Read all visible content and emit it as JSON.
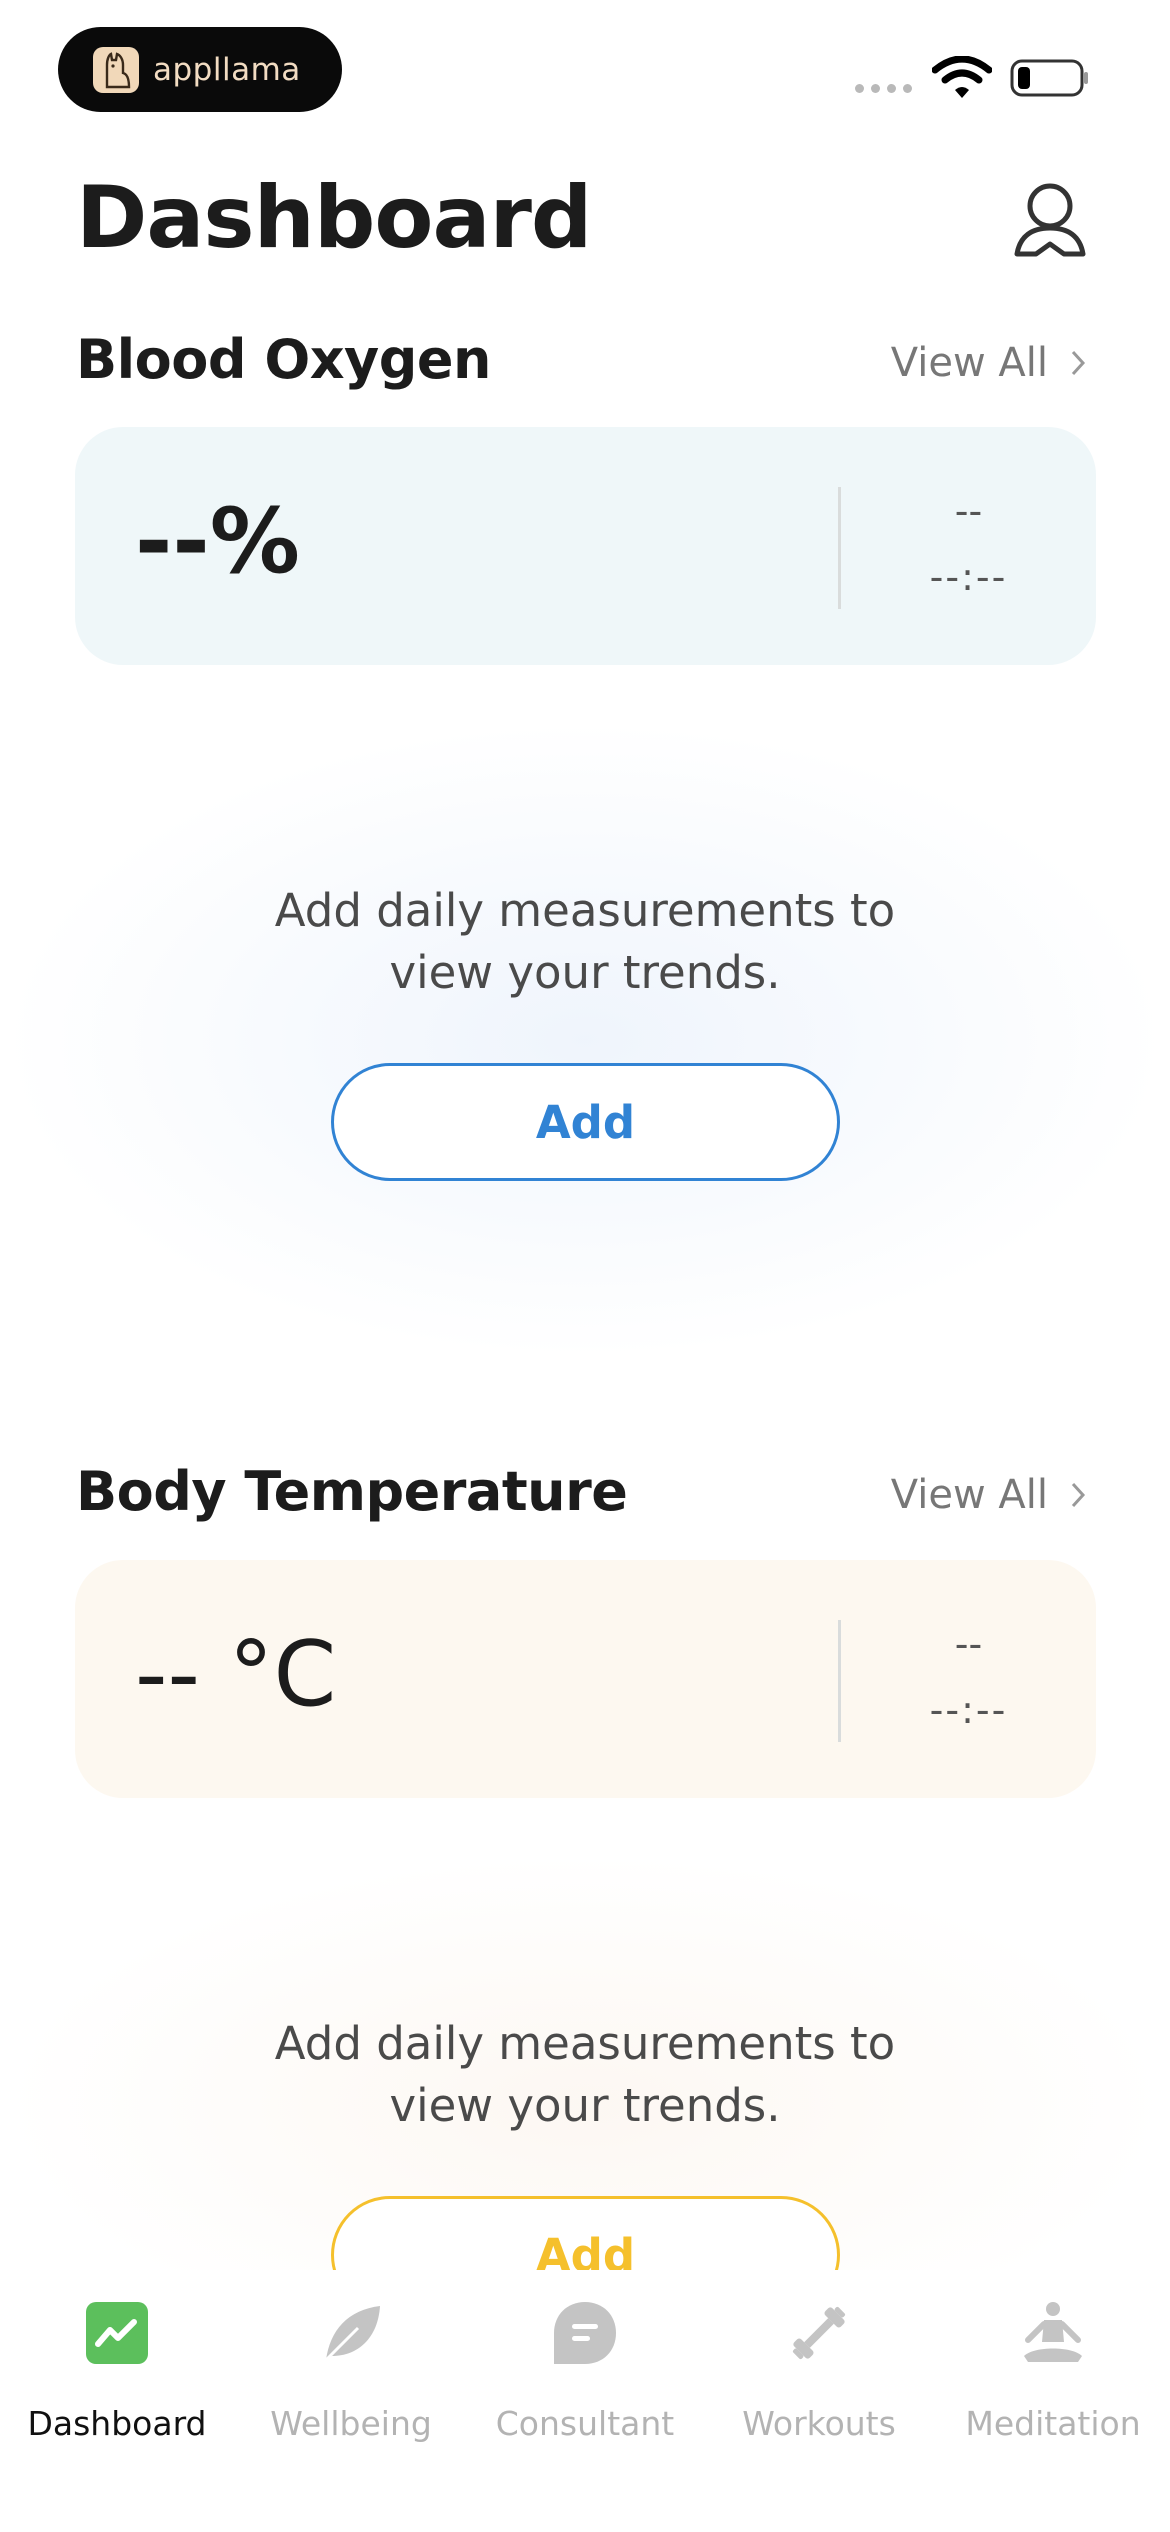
{
  "status_bar": {
    "app_badge_label": "appllama"
  },
  "header": {
    "title": "Dashboard"
  },
  "blood_oxygen": {
    "title": "Blood Oxygen",
    "view_all": "View All",
    "value": "--%",
    "date": "--",
    "time": "--:--",
    "empty_line1": "Add daily measurements to",
    "empty_line2": "view your trends.",
    "add_label": "Add",
    "accent": "#3183d4",
    "card_bg": "#eff7f9"
  },
  "body_temperature": {
    "title": "Body Temperature",
    "view_all": "View All",
    "value": "-- °C",
    "date": "--",
    "time": "--:--",
    "empty_line1": "Add daily measurements to",
    "empty_line2": "view your trends.",
    "add_label": "Add",
    "accent": "#f5c02c",
    "card_bg": "#fdf8f0"
  },
  "tabs": [
    {
      "label": "Dashboard",
      "icon": "dashboard-chart-icon",
      "active": true
    },
    {
      "label": "Wellbeing",
      "icon": "leaf-icon",
      "active": false
    },
    {
      "label": "Consultant",
      "icon": "chat-bubble-icon",
      "active": false
    },
    {
      "label": "Workouts",
      "icon": "dumbbell-icon",
      "active": false
    },
    {
      "label": "Meditation",
      "icon": "meditation-icon",
      "active": false
    }
  ]
}
